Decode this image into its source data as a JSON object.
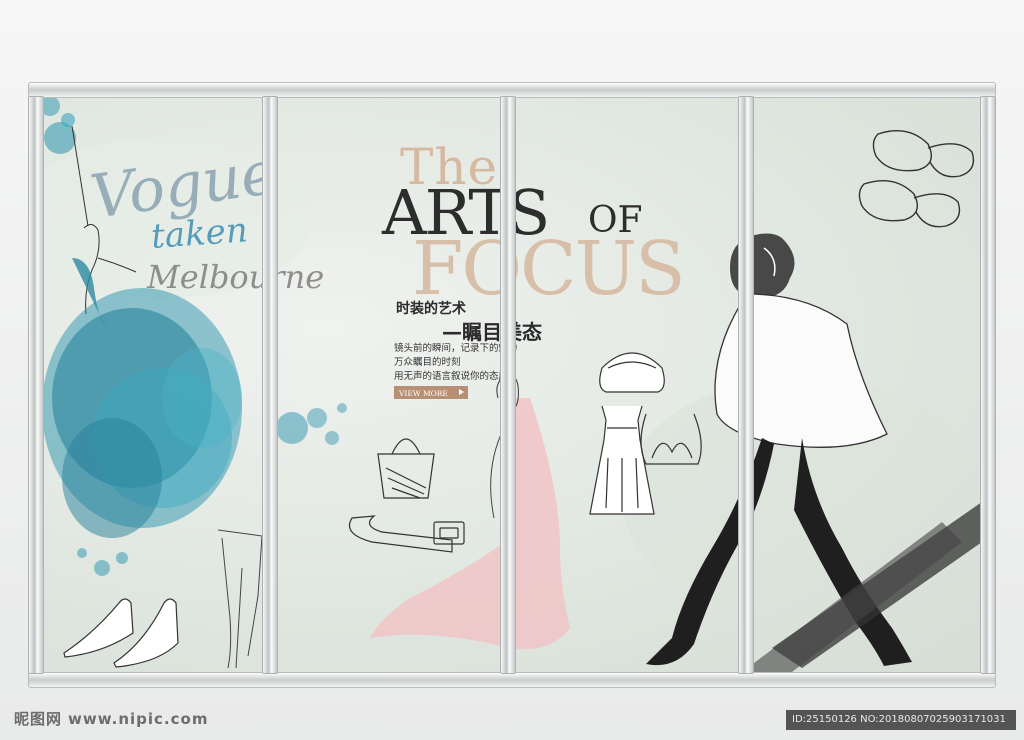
{
  "poster": {
    "headline_the": "The",
    "headline_arts": "ARTS",
    "headline_of": "OF",
    "headline_focus": "FOCUS",
    "subtitle_1": "时装的艺术",
    "subtitle_2": "—瞩目美态",
    "body_lines": [
      "镜头前的瞬间，记录下的魅力",
      "万众瞩目的时刻",
      "用无声的语言叙说你的态度"
    ],
    "button_label": "VIEW MORE",
    "script_text": [
      "Vogue",
      "taken",
      "Melbourne"
    ]
  },
  "watermark": {
    "logo_text": "昵图网",
    "url": "www.nipic.com",
    "id_text": "ID:25150126 NO:20180807025903171031"
  },
  "colors": {
    "accent_beige": "#d6b9a2",
    "watercolor_blue": "#2a93ad",
    "skirt_pink": "#f0c4c4",
    "button_brown": "#b78f74"
  }
}
